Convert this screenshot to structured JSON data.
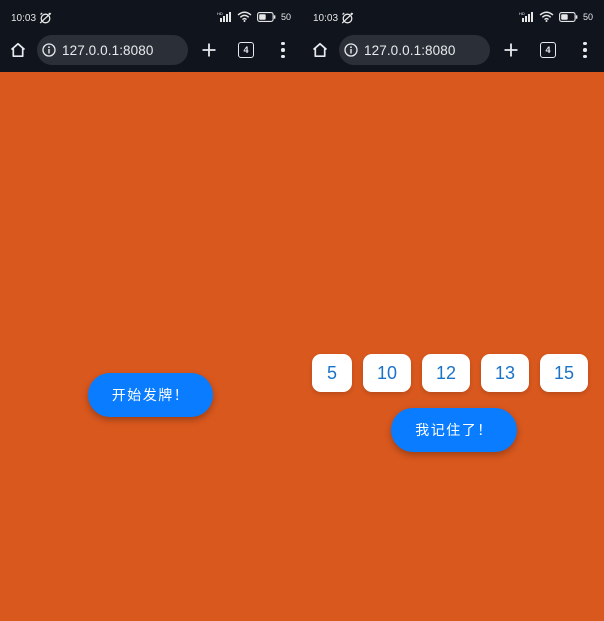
{
  "screens": [
    {
      "status": {
        "time": "10:03",
        "battery": "50"
      },
      "browser": {
        "url": "127.0.0.1:8080",
        "tab_count": "4"
      },
      "main": {
        "button_label": "开始发牌！"
      }
    },
    {
      "status": {
        "time": "10:03",
        "battery": "50"
      },
      "browser": {
        "url": "127.0.0.1:8080",
        "tab_count": "4"
      },
      "main": {
        "cards": [
          "5",
          "10",
          "12",
          "13",
          "15"
        ],
        "button_label": "我记住了！"
      }
    }
  ],
  "icons": {
    "status": [
      "alarm-off-icon",
      "signal-icon",
      "wifi-icon",
      "battery-icon"
    ],
    "toolbar": [
      "home-icon",
      "info-icon",
      "plus-icon",
      "tab-switcher-icon",
      "more-vert-icon"
    ]
  },
  "colors": {
    "background": "#d9581e",
    "browser_chrome": "#0f141d",
    "urlbar": "#2b3038",
    "button": "#0a7cff",
    "card": "#ffffff",
    "card_text": "#1a73c8"
  }
}
